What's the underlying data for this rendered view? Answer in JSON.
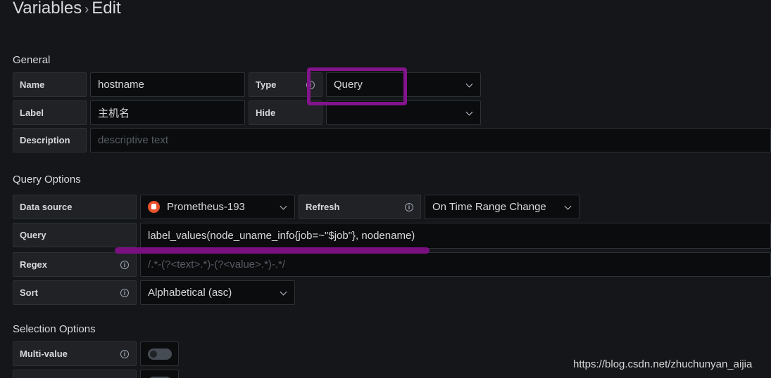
{
  "header": {
    "crumb1": "Variables",
    "separator": "›",
    "crumb2": "Edit"
  },
  "general": {
    "title": "General",
    "name_label": "Name",
    "name_value": "hostname",
    "type_label": "Type",
    "type_value": "Query",
    "label_label": "Label",
    "label_value": "主机名",
    "hide_label": "Hide",
    "hide_value": "",
    "description_label": "Description",
    "description_placeholder": "descriptive text"
  },
  "query_options": {
    "title": "Query Options",
    "datasource_label": "Data source",
    "datasource_value": "Prometheus-193",
    "refresh_label": "Refresh",
    "refresh_value": "On Time Range Change",
    "query_label": "Query",
    "query_value": "label_values(node_uname_info{job=~\"$job\"}, nodename)",
    "regex_label": "Regex",
    "regex_placeholder": "/.*-(?<text>.*)-(?<value>.*)-.*/",
    "sort_label": "Sort",
    "sort_value": "Alphabetical (asc)"
  },
  "selection_options": {
    "title": "Selection Options",
    "multivalue_label": "Multi-value",
    "multivalue_on": false,
    "includeall_on": false
  },
  "icons": {
    "info": "info-circle-icon",
    "chevron": "chevron-down-icon",
    "datasource": "prometheus-icon"
  },
  "colors": {
    "background": "#141619",
    "annotation_purple": "#82148c",
    "prometheus": "#e6522c"
  },
  "watermark": "https://blog.csdn.net/zhuchunyan_aijia"
}
